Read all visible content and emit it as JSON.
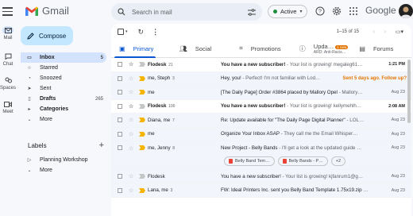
{
  "app": {
    "title": "Gmail",
    "brand": "Google"
  },
  "rail": [
    {
      "label": "Mail",
      "badge": ""
    },
    {
      "label": "Chat"
    },
    {
      "label": "Spaces"
    },
    {
      "label": "Meet"
    }
  ],
  "search": {
    "placeholder": "Search in mail"
  },
  "status": {
    "label": "Active",
    "color": "#1e8e3e"
  },
  "compose": {
    "label": "Compose"
  },
  "nav": [
    {
      "label": "Inbox",
      "count": "5",
      "icon": "inbox-icon"
    },
    {
      "label": "Starred",
      "count": "",
      "icon": "star-icon"
    },
    {
      "label": "Snoozed",
      "count": "",
      "icon": "clock-icon"
    },
    {
      "label": "Sent",
      "count": "",
      "icon": "send-icon"
    },
    {
      "label": "Drafts",
      "count": "265",
      "icon": "draft-icon"
    },
    {
      "label": "Categories",
      "count": "",
      "icon": "tag-icon"
    },
    {
      "label": "More",
      "count": "",
      "icon": "chevron-down-icon"
    }
  ],
  "labels": {
    "heading": "Labels",
    "items": [
      {
        "label": "Planning Workshop"
      },
      {
        "label": "More"
      }
    ]
  },
  "toolbar": {
    "pager": "1–15 of 15"
  },
  "tabs": [
    {
      "label": "Primary",
      "sub": "",
      "badge": ""
    },
    {
      "label": "Social",
      "sub": "",
      "badge": ""
    },
    {
      "label": "Promotions",
      "sub": "",
      "badge": ""
    },
    {
      "label": "Upda…",
      "sub": "ARD: Anti-Racis…",
      "badge": "1 new"
    },
    {
      "label": "Forums",
      "sub": "",
      "badge": ""
    }
  ],
  "emails": [
    {
      "sender": "Flodesk",
      "count": "21",
      "subject": "You have a new subscriber!",
      "snippet": " - Your list is growing! megaleg61…",
      "date": "1:21 PM",
      "unread": true,
      "important": false
    },
    {
      "sender": "me, Steph",
      "count": "3",
      "subject": "Hey, you!",
      "snippet": " - Perfect! I'm not familiar with Lod…",
      "date": "",
      "followup": "Sent 5 days ago. Follow up?",
      "unread": false,
      "important": true
    },
    {
      "sender": "me",
      "count": "",
      "subject": "[The Daily Page] Order #3864 placed by Mallory Opel",
      "snippet": " - Mallory…",
      "date": "Aug 23",
      "unread": false,
      "important": true
    },
    {
      "sender": "Flodesk",
      "count": "100",
      "subject": "You have a new subscriber!",
      "snippet": " - Your list is growing! kellymehlh…",
      "date": "2:08 AM",
      "unread": true,
      "important": false
    },
    {
      "sender": "Diana, me",
      "count": "7",
      "subject": "Re: Update available for \"The Daily Page Digital Planner\"",
      "snippet": " - LOL…",
      "date": "Aug 23",
      "unread": false,
      "important": true
    },
    {
      "sender": "me",
      "count": "",
      "subject": "Organize Your Inbox ASAP",
      "snippet": " - They call me the Email Whisper…",
      "date": "Aug 23",
      "unread": false,
      "important": true
    },
    {
      "sender": "me, Jenny",
      "count": "8",
      "subject": "New Project - Belly Bands",
      "snippet": " - I'll get a look at the updated guide …",
      "date": "Aug 23",
      "unread": false,
      "important": true,
      "attachments": [
        "Belly Band Tem…",
        "Belly Bands - P…"
      ],
      "more": "+2"
    },
    {
      "sender": "Flodesk",
      "count": "",
      "subject": "You have a new subscriber!",
      "snippet": " - Your list is growing! kjfanrum1@g…",
      "date": "Aug 23",
      "unread": false,
      "important": false
    },
    {
      "sender": "Lana, me",
      "count": "3",
      "subject": "FW: Ideal Printers Inc. sent you Belly Band Template 1.75x19.zip",
      "snippet": " …",
      "date": "Aug 23",
      "unread": false,
      "important": true
    }
  ],
  "colors": {
    "accent": "#0b57d0",
    "compose": "#c2e7ff",
    "important": "#f4b400",
    "followup": "#e37400"
  }
}
